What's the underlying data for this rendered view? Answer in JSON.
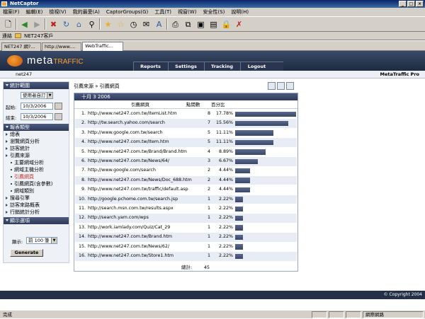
{
  "window": {
    "title": "NetCaptor"
  },
  "menu": [
    "檔案(F)",
    "編輯(E)",
    "檢視(V)",
    "我的最愛(A)",
    "CaptorGroups(G)",
    "工具(T)",
    "視窗(W)",
    "安全性(S)",
    "說明(H)"
  ],
  "address": {
    "label": "連結",
    "folder": "NET247客戶"
  },
  "tabs": [
    "NET247 網?...",
    "http://www....",
    "WebTraffic..."
  ],
  "site": {
    "logo_meta": "meta",
    "logo_traffic": "TRAFFIC",
    "nav": [
      "Reports",
      "Settings",
      "Tracking",
      "Logout"
    ],
    "account": "net247",
    "product": "MetaTraffic Pro"
  },
  "sidebar": {
    "stats_header": "統計範圍",
    "date_range_select": "使用者自訂",
    "start_label": "起始:",
    "start_value": "10/3/2006",
    "end_label": "結束:",
    "end_value": "10/3/2006",
    "report_header": "報表類型",
    "items": [
      {
        "label": "總表",
        "kind": "bullet"
      },
      {
        "label": "瀏覽網頁分析",
        "kind": "bullet"
      },
      {
        "label": "訪客統計",
        "kind": "bullet"
      },
      {
        "label": "引薦來源",
        "kind": "bullet"
      },
      {
        "label": "主要網域分析",
        "kind": "sub"
      },
      {
        "label": "網域主機分析",
        "kind": "sub"
      },
      {
        "label": "引薦網頁",
        "kind": "sub",
        "active": true
      },
      {
        "label": "引薦網頁(含參數)",
        "kind": "sub"
      },
      {
        "label": "網域類別",
        "kind": "sub"
      },
      {
        "label": "搜尋引擎",
        "kind": "bullet"
      },
      {
        "label": "訪客來路概表",
        "kind": "bullet"
      },
      {
        "label": "行銷統計分析",
        "kind": "bullet"
      }
    ],
    "display_header": "顯示選項",
    "display_label": "顯示:",
    "display_value": "前 100 筆",
    "generate": "Generate"
  },
  "main": {
    "breadcrumb": "引薦來源 » 引薦網頁",
    "date_header": "十月 3 2006",
    "col_url": "引薦網頁",
    "col_count": "點閱數",
    "col_pct": "百分比",
    "rows": [
      {
        "n": "1.",
        "url": "http://www.net247.com.tw/ItemList.htm",
        "count": "8",
        "pct": "17.78%",
        "value": 17.78
      },
      {
        "n": "2.",
        "url": "http://tw.search.yahoo.com/search",
        "count": "7",
        "pct": "15.56%",
        "value": 15.56
      },
      {
        "n": "3.",
        "url": "http://www.google.com.tw/search",
        "count": "5",
        "pct": "11.11%",
        "value": 11.11
      },
      {
        "n": "4.",
        "url": "http://www.net247.com.tw/Item.htm",
        "count": "5",
        "pct": "11.11%",
        "value": 11.11
      },
      {
        "n": "5.",
        "url": "http://www.net247.com.tw/Brand/Brand.htm",
        "count": "4",
        "pct": "8.89%",
        "value": 8.89
      },
      {
        "n": "6.",
        "url": "http://www.net247.com.tw/News/64/",
        "count": "3",
        "pct": "6.67%",
        "value": 6.67
      },
      {
        "n": "7.",
        "url": "http://www.google.com/search",
        "count": "2",
        "pct": "4.44%",
        "value": 4.44
      },
      {
        "n": "8.",
        "url": "http://www.net247.com.tw/News/Doc_688.htm",
        "count": "2",
        "pct": "4.44%",
        "value": 4.44
      },
      {
        "n": "9.",
        "url": "http://www.net247.com.tw/traffic/default.asp",
        "count": "2",
        "pct": "4.44%",
        "value": 4.44
      },
      {
        "n": "10.",
        "url": "http://google.pchome.com.tw/search.jsp",
        "count": "1",
        "pct": "2.22%",
        "value": 2.22
      },
      {
        "n": "11.",
        "url": "http://search.msn.com.tw/results.aspx",
        "count": "1",
        "pct": "2.22%",
        "value": 2.22
      },
      {
        "n": "12.",
        "url": "http://search.yam.com/wps",
        "count": "1",
        "pct": "2.22%",
        "value": 2.22
      },
      {
        "n": "13.",
        "url": "http://work.iamlady.com/Quiz/Cat_29",
        "count": "1",
        "pct": "2.22%",
        "value": 2.22
      },
      {
        "n": "14.",
        "url": "http://www.net247.com.tw/Brand.htm",
        "count": "1",
        "pct": "2.22%",
        "value": 2.22
      },
      {
        "n": "15.",
        "url": "http://www.net247.com.tw/News/62/",
        "count": "1",
        "pct": "2.22%",
        "value": 2.22
      },
      {
        "n": "16.",
        "url": "http://www.net247.com.tw/Store1.htm",
        "count": "1",
        "pct": "2.22%",
        "value": 2.22
      }
    ],
    "total_label": "總計:",
    "total_value": "45"
  },
  "footer": {
    "copyright": "© Copyright 2004"
  },
  "status": {
    "left": "完成",
    "zone": "網際網路"
  }
}
